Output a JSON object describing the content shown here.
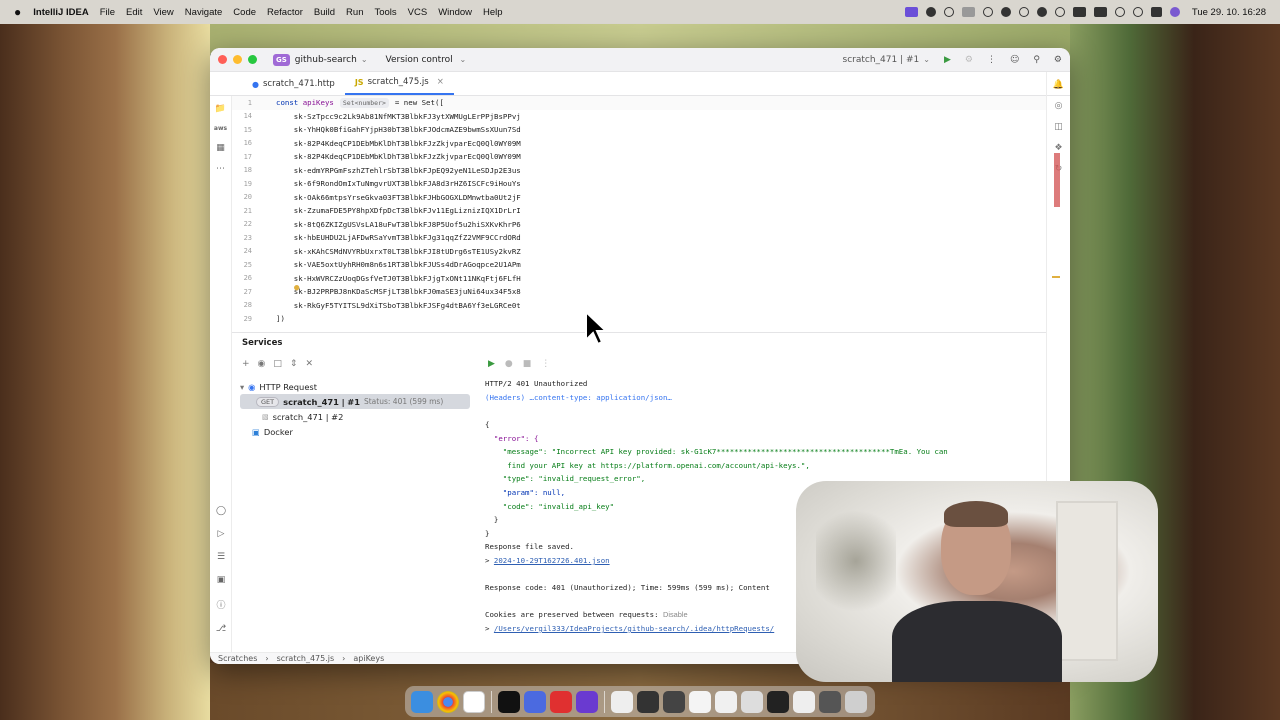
{
  "menubar": {
    "apple": "",
    "app": "IntelliJ IDEA",
    "items": [
      "File",
      "Edit",
      "View",
      "Navigate",
      "Code",
      "Refactor",
      "Build",
      "Run",
      "Tools",
      "VCS",
      "Window",
      "Help"
    ],
    "clock": "Tue 29. 10.  16:28"
  },
  "titlebar": {
    "project_badge": "GS",
    "project": "github-search",
    "vcs": "Version control",
    "run_config": "scratch_471 | #1"
  },
  "tabs": [
    {
      "label": "scratch_471.http",
      "type": "http"
    },
    {
      "label": "scratch_475.js",
      "type": "js",
      "active": true
    }
  ],
  "editor": {
    "first_line": {
      "num": "1",
      "kw1": "const",
      "var": "apiKeys",
      "hint": "Set<number>",
      "rest": "= new Set(["
    },
    "lines": [
      {
        "num": "14",
        "code": "    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"
      },
      {
        "num": "15",
        "code": "    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"
      },
      {
        "num": "16",
        "code": "    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"
      },
      {
        "num": "17",
        "code": "    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"
      },
      {
        "num": "18",
        "code": "    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"
      },
      {
        "num": "19",
        "code": "    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"
      },
      {
        "num": "20",
        "code": "    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"
      },
      {
        "num": "21",
        "code": "    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"
      },
      {
        "num": "22",
        "code": "    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"
      },
      {
        "num": "23",
        "code": "    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"
      },
      {
        "num": "24",
        "code": "    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"
      },
      {
        "num": "25",
        "code": "    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"
      },
      {
        "num": "26",
        "code": "    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"
      },
      {
        "num": "27",
        "code": "    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"
      },
      {
        "num": "28",
        "code": "    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"
      }
    ],
    "last_line": {
      "num": "29",
      "code": "])"
    }
  },
  "services": {
    "title": "Services",
    "tree": {
      "group": "HTTP Request",
      "items": [
        {
          "badge": "GET",
          "name": "scratch_471",
          "sep": "|",
          "run": "#1",
          "status": "Status: 401 (599 ms)",
          "selected": true
        },
        {
          "name": "scratch_471",
          "sep": "|",
          "run": "#2"
        }
      ],
      "docker": "Docker"
    },
    "response": {
      "status_line": "HTTP/2 401 Unauthorized",
      "headers": "(Headers) …content-type: application/json…",
      "open_brace": "{",
      "error_key": "  \"error\": {",
      "message_line1": "    \"message\": \"Incorrect API key provided: sk-G1cK7***************************************TmEa. You can",
      "message_line2": "     find your API key at https://platform.openai.com/account/api-keys.\",",
      "type_line": "    \"type\": \"invalid_request_error\",",
      "param_line": "    \"param\": null,",
      "code_line": "    \"code\": \"invalid_api_key\"",
      "close_inner": "  }",
      "close_outer": "}",
      "saved": "Response file saved.",
      "saved_prefix": "> ",
      "saved_file": "2024-10-29T162726.401.json",
      "summary": "Response code: 401 (Unauthorized); Time: 599ms (599 ms); Content",
      "cookies": "Cookies are preserved between requests:",
      "cookies_action": "Disable",
      "path_prefix": "> ",
      "path": "/Users/vergil333/IdeaProjects/github-search/.idea/httpRequests/"
    }
  },
  "statusbar": {
    "crumbs": [
      "Scratches",
      "scratch_475.js",
      "apiKeys"
    ]
  },
  "colors": {
    "accent": "#3574f0",
    "string": "#067d17",
    "keyword": "#0033b3",
    "error_stripe": "#d45a5a"
  }
}
